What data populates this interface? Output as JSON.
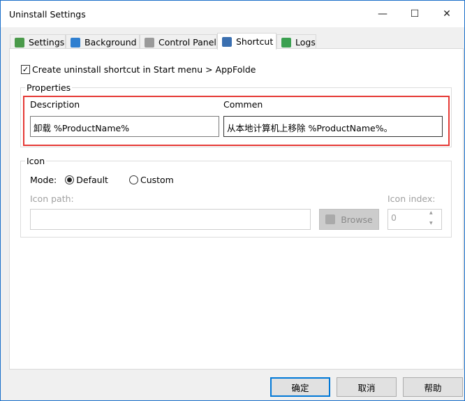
{
  "window": {
    "title": "Uninstall Settings",
    "minimize": "—",
    "maximize": "☐",
    "close": "✕"
  },
  "tabs": [
    {
      "label": "Settings",
      "icon": "recycle-bin-icon",
      "color": "#4a9a4a"
    },
    {
      "label": "Background",
      "icon": "windows-refresh-icon",
      "color": "#2f7fd0"
    },
    {
      "label": "Control Panel",
      "icon": "control-panel-icon",
      "color": "#9a9a9a"
    },
    {
      "label": "Shortcut",
      "icon": "shortcut-icon",
      "color": "#3a6fb0"
    },
    {
      "label": "Logs",
      "icon": "log-refresh-icon",
      "color": "#3aa050"
    }
  ],
  "active_tab": "Shortcut",
  "shortcut": {
    "create_checkbox": {
      "label": "Create uninstall shortcut in Start menu > AppFolde",
      "checked": true,
      "mark": "✓"
    },
    "properties": {
      "title": "Properties",
      "description_label": "Description",
      "description_value": "卸载 %ProductName%",
      "comment_label": "Commen",
      "comment_value": "从本地计算机上移除 %ProductName%。"
    },
    "icon": {
      "title": "Icon",
      "mode_label": "Mode:",
      "modes": [
        "Default",
        "Custom"
      ],
      "selected_mode": "Default",
      "path_label": "Icon path:",
      "path_value": "",
      "browse_label": "Browse",
      "index_label": "Icon index:",
      "index_value": "0",
      "spin_up": "▲",
      "spin_down": "▼"
    }
  },
  "buttons": {
    "ok": "确定",
    "cancel": "取消",
    "help": "帮助"
  },
  "highlight_color": "#e53935"
}
